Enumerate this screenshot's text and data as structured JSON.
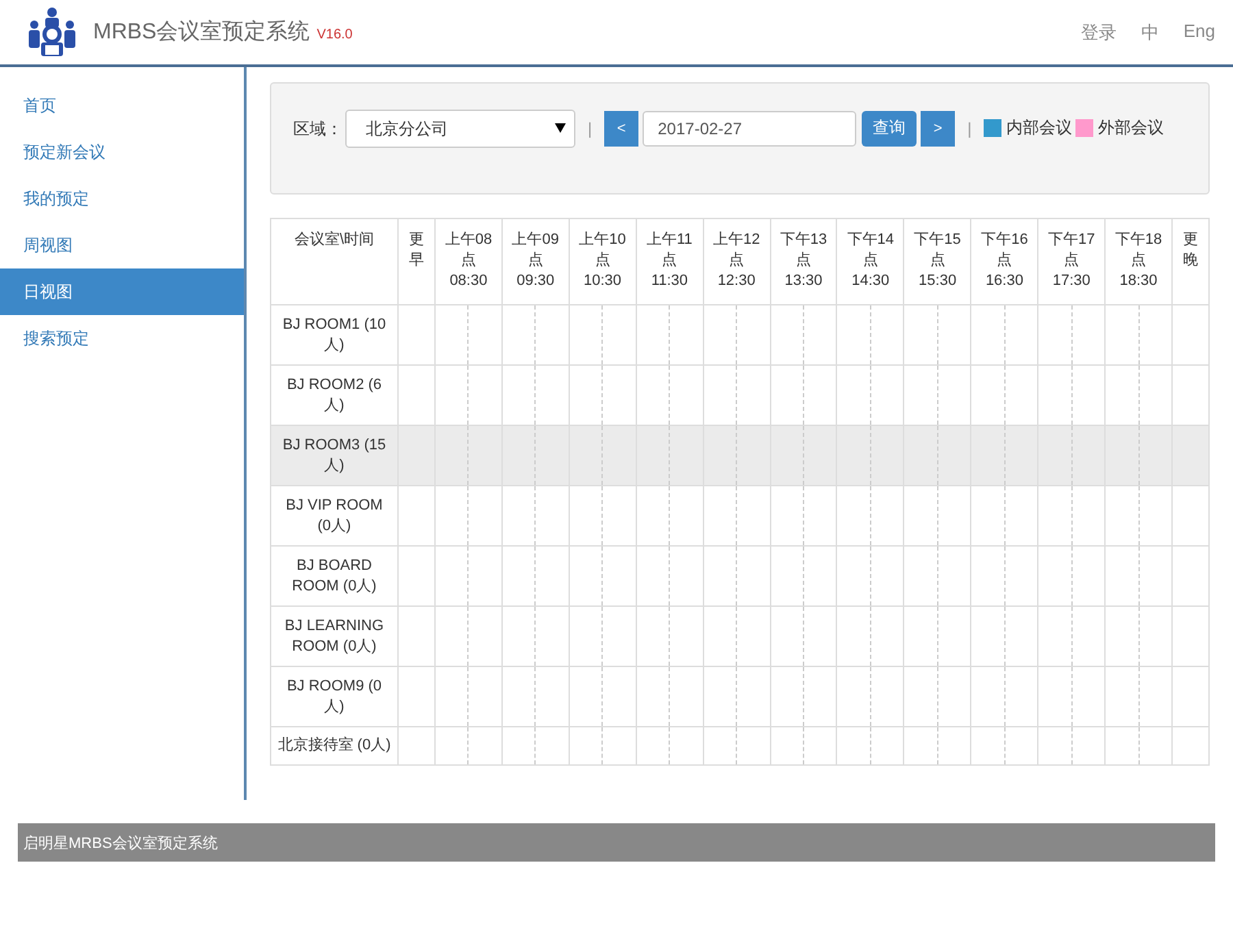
{
  "header": {
    "title": "MRBS会议室预定系统",
    "version": "V16.0",
    "links": [
      {
        "label": "登录"
      },
      {
        "label": "中"
      },
      {
        "label": "Eng"
      }
    ]
  },
  "sidebar": {
    "items": [
      {
        "label": "首页",
        "selected": false
      },
      {
        "label": "预定新会议",
        "selected": false
      },
      {
        "label": "我的预定",
        "selected": false
      },
      {
        "label": "周视图",
        "selected": false
      },
      {
        "label": "日视图",
        "selected": true
      },
      {
        "label": "搜索预定",
        "selected": false
      }
    ]
  },
  "filter": {
    "area_label": "区域：",
    "area_value": "北京分公司",
    "prev": "<",
    "date": "2017-02-27",
    "query": "查询",
    "next": ">",
    "separator": "|",
    "legend": [
      {
        "label": "内部会议",
        "color": "#3399cc"
      },
      {
        "label": "外部会议",
        "color": "#ff99cc"
      }
    ]
  },
  "table": {
    "corner": "会议室\\时间",
    "before": "更早",
    "after": "更晚",
    "hours": [
      {
        "label": "上午08点",
        "time": "08:30"
      },
      {
        "label": "上午09点",
        "time": "09:30"
      },
      {
        "label": "上午10点",
        "time": "10:30"
      },
      {
        "label": "上午11点",
        "time": "11:30"
      },
      {
        "label": "上午12点",
        "time": "12:30"
      },
      {
        "label": "下午13点",
        "time": "13:30"
      },
      {
        "label": "下午14点",
        "time": "14:30"
      },
      {
        "label": "下午15点",
        "time": "15:30"
      },
      {
        "label": "下午16点",
        "time": "16:30"
      },
      {
        "label": "下午17点",
        "time": "17:30"
      },
      {
        "label": "下午18点",
        "time": "18:30"
      }
    ],
    "rows": [
      {
        "room": "BJ ROOM1 (10人)",
        "selected": false
      },
      {
        "room": "BJ ROOM2 (6人)",
        "selected": false
      },
      {
        "room": "BJ ROOM3 (15人)",
        "selected": true
      },
      {
        "room": "BJ VIP ROOM (0人)",
        "selected": false
      },
      {
        "room": "BJ BOARD ROOM (0人)",
        "selected": false
      },
      {
        "room": "BJ LEARNING ROOM (0人)",
        "selected": false
      },
      {
        "room": "BJ ROOM9 (0人)",
        "selected": false
      },
      {
        "room": "北京接待室 (0人)",
        "selected": false
      }
    ]
  },
  "footer": {
    "text": "启明星MRBS会议室预定系统"
  }
}
